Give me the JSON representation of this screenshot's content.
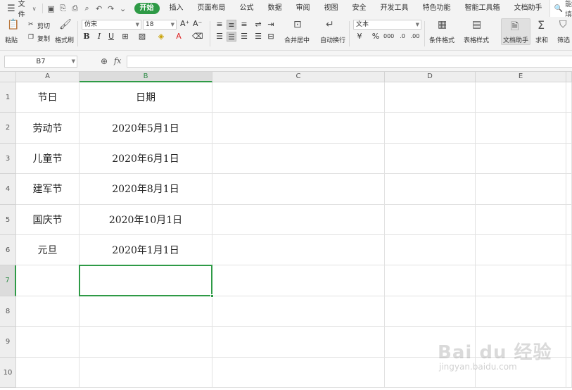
{
  "menubar": {
    "file_label": "文件",
    "tabs": [
      {
        "label": "开始",
        "active": true
      },
      {
        "label": "插入"
      },
      {
        "label": "页面布局"
      },
      {
        "label": "公式"
      },
      {
        "label": "数据"
      },
      {
        "label": "审阅"
      },
      {
        "label": "视图"
      },
      {
        "label": "安全"
      },
      {
        "label": "开发工具"
      },
      {
        "label": "特色功能"
      },
      {
        "label": "智能工具箱"
      },
      {
        "label": "文档助手"
      }
    ],
    "search_label": "智能填充"
  },
  "ribbon": {
    "paste": "粘贴",
    "cut": "剪切",
    "copy": "复制",
    "format_painter": "格式刷",
    "font_name": "仿宋",
    "font_size": "18",
    "bold": "B",
    "italic": "I",
    "underline": "U",
    "merge_center": "合并居中",
    "wrap_text": "自动换行",
    "number_format": "文本",
    "conditional_format": "条件格式",
    "table_style": "表格样式",
    "doc_assistant": "文档助手",
    "sum": "求和",
    "filter": "筛选"
  },
  "formula_bar": {
    "name_box": "B7",
    "fx_label": "fx",
    "formula": ""
  },
  "sheet": {
    "columns": [
      "A",
      "B",
      "C",
      "D",
      "E"
    ],
    "rows": [
      "1",
      "2",
      "3",
      "4",
      "5",
      "6",
      "7",
      "8",
      "9",
      "10"
    ],
    "selected_column": "B",
    "selected_row": "7",
    "cells": {
      "A1": "节日",
      "B1": "日期",
      "A2": "劳动节",
      "B2": "2020年5月1日",
      "A3": "儿童节",
      "B3": "2020年6月1日",
      "A4": "建军节",
      "B4": "2020年8月1日",
      "A5": "国庆节",
      "B5": "2020年10月1日",
      "A6": "元旦",
      "B6": "2020年1月1日"
    }
  },
  "watermark": {
    "main": "Bai du 经验",
    "sub": "jingyan.baidu.com"
  }
}
